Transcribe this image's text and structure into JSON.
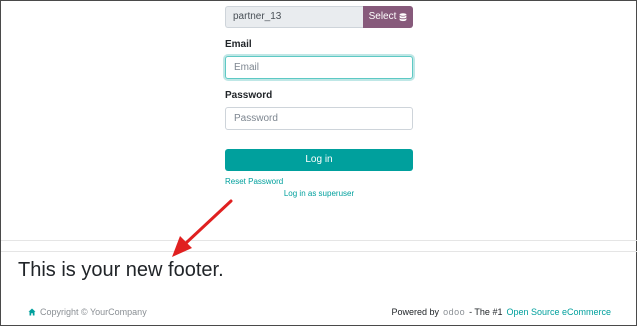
{
  "login": {
    "database_value": "partner_13",
    "select_label": "Select",
    "email_label": "Email",
    "email_placeholder": "Email",
    "password_label": "Password",
    "password_placeholder": "Password",
    "login_button": "Log in",
    "reset_password": "Reset Password",
    "superuser_link": "Log in as superuser"
  },
  "footer": {
    "custom_text": "This is your new footer.",
    "copyright": "Copyright © YourCompany",
    "powered_by": "Powered by",
    "logo_text": "odoo",
    "tagline": "- The #1",
    "ecommerce_link": "Open Source eCommerce"
  },
  "colors": {
    "primary": "#00a09d",
    "select_button": "#875a7b",
    "annotation_arrow": "#e02020"
  },
  "icons": {
    "database": "database-icon",
    "home": "home-icon",
    "annotation": "arrow-annotation-icon"
  }
}
